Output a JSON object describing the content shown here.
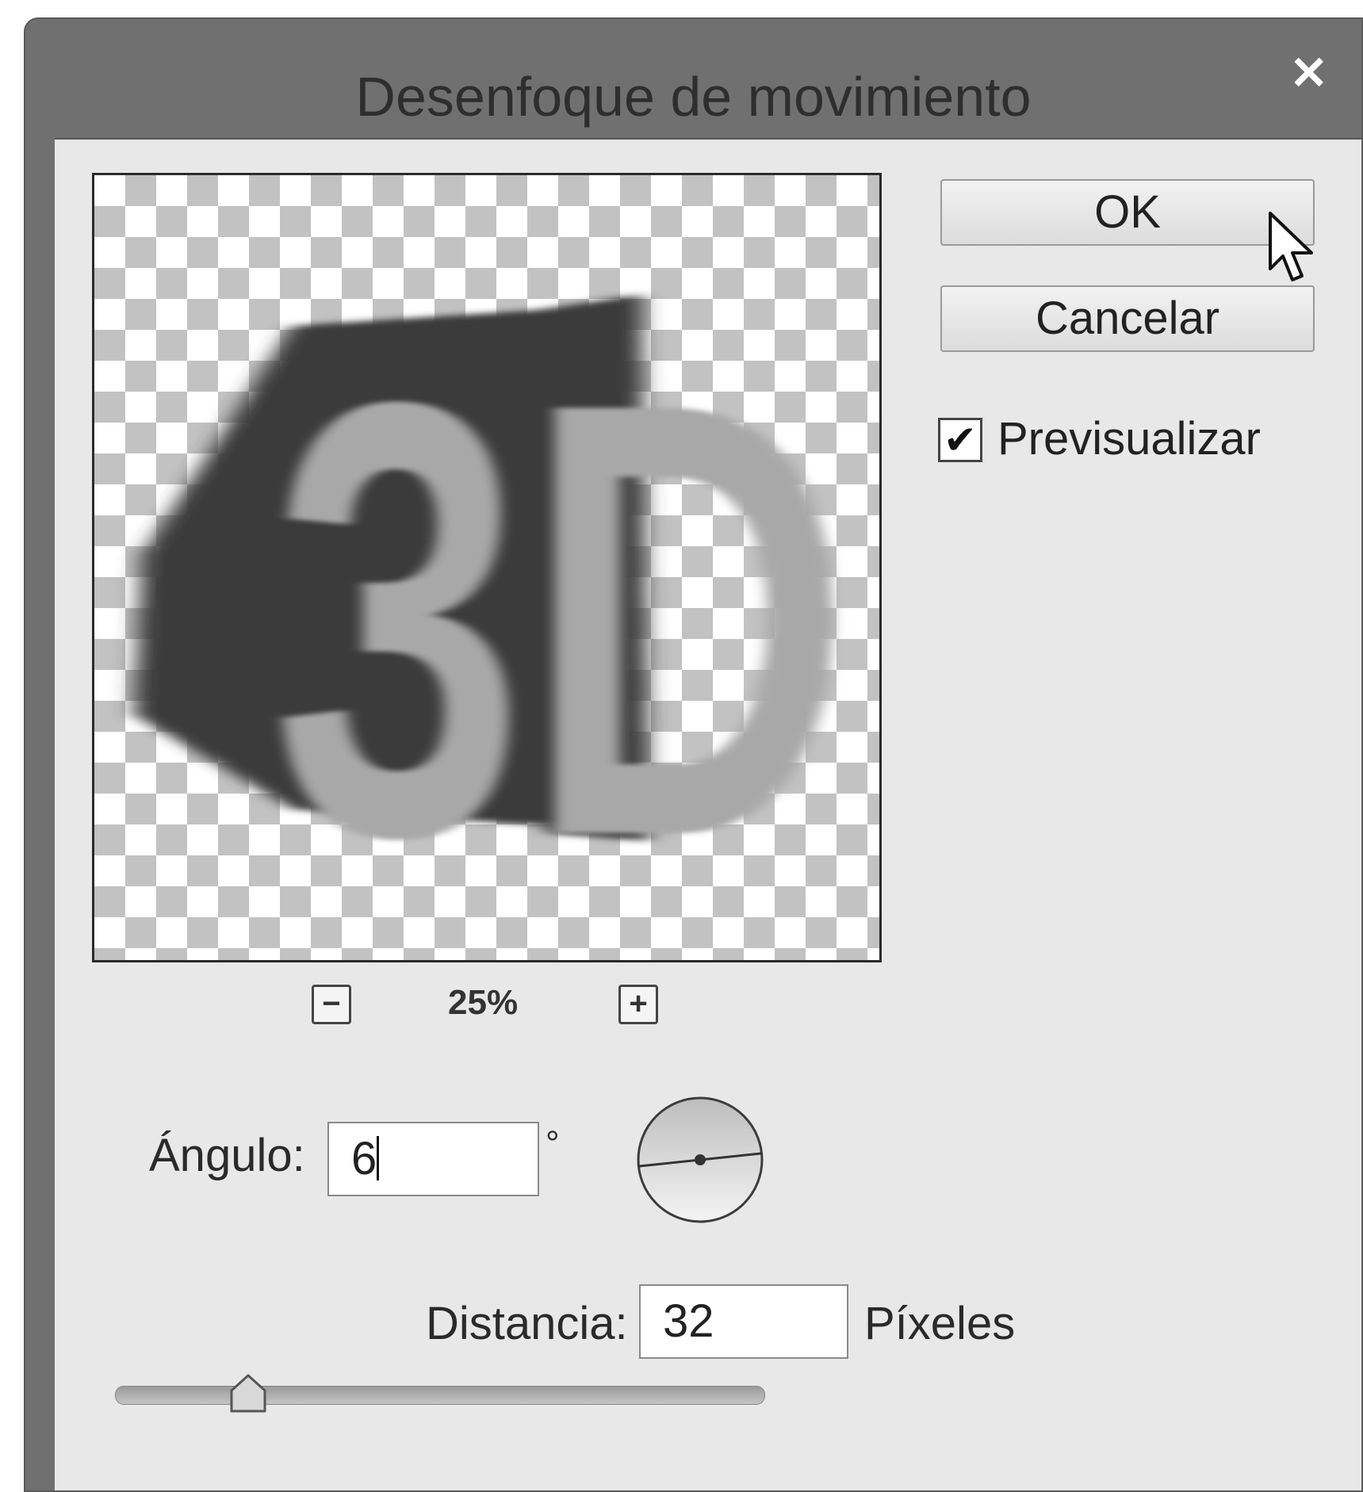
{
  "dialog": {
    "title": "Desenfoque de movimiento",
    "close_glyph": "✕"
  },
  "preview": {
    "content_text": "3D",
    "zoom_out_glyph": "−",
    "zoom_in_glyph": "+",
    "zoom_level": "25%"
  },
  "buttons": {
    "ok_label": "OK",
    "cancel_label": "Cancelar"
  },
  "preview_toggle": {
    "label": "Previsualizar",
    "checked": true,
    "check_glyph": "✔"
  },
  "angle": {
    "label": "Ángulo:",
    "value": "6",
    "unit": "°",
    "degrees": 6
  },
  "distance": {
    "label": "Distancia:",
    "value": "32",
    "unit": "Píxeles",
    "slider_fraction": 0.17
  },
  "icons": {
    "close": "close-icon",
    "zoom_out": "zoom-out-icon",
    "zoom_in": "zoom-in-icon",
    "check": "checkmark-icon",
    "cursor": "mouse-pointer-icon",
    "dial": "angle-dial-icon"
  }
}
